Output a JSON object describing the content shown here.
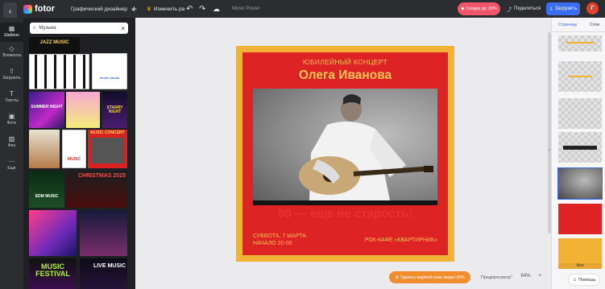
{
  "topbar": {
    "brand": "fotor",
    "design_type": "Графический дизайнер",
    "resize_label": "Изменить ра",
    "doc_name": "Music Poster",
    "sale_label": "Скидка до 30%",
    "share_label": "Поделиться",
    "download_label": "Загрузить",
    "avatar_letter": "Г"
  },
  "rail": [
    {
      "icon": "template-icon",
      "label": "Шаблон"
    },
    {
      "icon": "elements-icon",
      "label": "Элементы"
    },
    {
      "icon": "upload-icon",
      "label": "Загрузить"
    },
    {
      "icon": "text-icon",
      "label": "Тексты"
    },
    {
      "icon": "photo-icon",
      "label": "Фото"
    },
    {
      "icon": "background-icon",
      "label": "Фон"
    },
    {
      "icon": "more-icon",
      "label": "Еще"
    }
  ],
  "search": {
    "value": "Музыка"
  },
  "templates": {
    "t1": "JAZZ MUSIC",
    "t2": "SUMMER NIGHT",
    "t3": "STARRY NIGHT",
    "t4": "MUSIC CONCERT",
    "t5": "CHRISTMAS 2025",
    "t6": "EDM MUSIC",
    "t7": "MUSIC FESTIVAL",
    "t8": "LIVE MUSIC",
    "t9": "music studio",
    "t10": "MUSIC"
  },
  "poster": {
    "subtitle": "ЮБИЛЕЙНЫЙ КОНЦЕРТ",
    "title": "Олега Иванова",
    "slogan": "50 — еще не старость!",
    "date_line1": "СУББОТА, 7 МАРТА",
    "date_line2": "НАЧАЛО 20-00",
    "venue": "РОК-КАФЕ «КВАРТИРНИК»"
  },
  "footer": {
    "watermark_label": "Удалить водяной знак скидка 30%",
    "preview_label": "Предпросмотр",
    "zoom_value": "64%"
  },
  "pages_panel": {
    "tab_pages": "Страницы",
    "tab_layers": "Слои",
    "bg_label": "Фон",
    "help_label": "Помощь"
  },
  "colors": {
    "accent": "#3a6df0",
    "poster_red": "#dd2323",
    "poster_gold": "#f2b233",
    "sale": "#f0566b"
  }
}
